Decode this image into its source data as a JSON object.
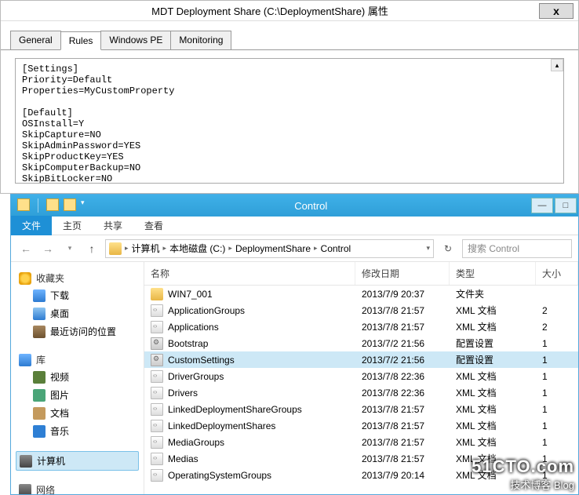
{
  "dialog": {
    "title": "MDT Deployment Share (C:\\DeploymentShare) 属性",
    "close": "x",
    "tabs": [
      "General",
      "Rules",
      "Windows PE",
      "Monitoring"
    ],
    "activeTab": 1,
    "content": "[Settings]\nPriority=Default\nProperties=MyCustomProperty\n\n[Default]\nOSInstall=Y\nSkipCapture=NO\nSkipAdminPassword=YES\nSkipProductKey=YES\nSkipComputerBackup=NO\nSkipBitLocker=NO"
  },
  "explorer": {
    "title": "Control",
    "winbtns": {
      "min": "—",
      "max": "□"
    },
    "ribbon": {
      "file": "文件",
      "tabs": [
        "主页",
        "共享",
        "查看"
      ]
    },
    "nav": {
      "back": "←",
      "fwd": "→",
      "drop": "▾",
      "up": "↑",
      "segs": [
        "计算机",
        "本地磁盘 (C:)",
        "DeploymentShare",
        "Control"
      ],
      "refresh": "↻",
      "searchPlaceholder": "搜索 Control"
    },
    "sidebar": {
      "fav": {
        "label": "收藏夹",
        "items": [
          "下载",
          "桌面",
          "最近访问的位置"
        ]
      },
      "lib": {
        "label": "库",
        "items": [
          "视频",
          "图片",
          "文档",
          "音乐"
        ]
      },
      "comp": {
        "label": "计算机"
      },
      "net": {
        "label": "网络"
      }
    },
    "columns": {
      "name": "名称",
      "date": "修改日期",
      "type": "类型",
      "size": "大小"
    },
    "files": [
      {
        "icon": "fold",
        "name": "WIN7_001",
        "date": "2013/7/9 20:37",
        "type": "文件夹",
        "size": ""
      },
      {
        "icon": "xml",
        "name": "ApplicationGroups",
        "date": "2013/7/8 21:57",
        "type": "XML 文档",
        "size": "2"
      },
      {
        "icon": "xml",
        "name": "Applications",
        "date": "2013/7/8 21:57",
        "type": "XML 文档",
        "size": "2"
      },
      {
        "icon": "cfg",
        "name": "Bootstrap",
        "date": "2013/7/2 21:56",
        "type": "配置设置",
        "size": "1"
      },
      {
        "icon": "cfg",
        "name": "CustomSettings",
        "date": "2013/7/2 21:56",
        "type": "配置设置",
        "size": "1",
        "sel": true
      },
      {
        "icon": "xml",
        "name": "DriverGroups",
        "date": "2013/7/8 22:36",
        "type": "XML 文档",
        "size": "1"
      },
      {
        "icon": "xml",
        "name": "Drivers",
        "date": "2013/7/8 22:36",
        "type": "XML 文档",
        "size": "1"
      },
      {
        "icon": "xml",
        "name": "LinkedDeploymentShareGroups",
        "date": "2013/7/8 21:57",
        "type": "XML 文档",
        "size": "1"
      },
      {
        "icon": "xml",
        "name": "LinkedDeploymentShares",
        "date": "2013/7/8 21:57",
        "type": "XML 文档",
        "size": "1"
      },
      {
        "icon": "xml",
        "name": "MediaGroups",
        "date": "2013/7/8 21:57",
        "type": "XML 文档",
        "size": "1"
      },
      {
        "icon": "xml",
        "name": "Medias",
        "date": "2013/7/8 21:57",
        "type": "XML 文档",
        "size": "1"
      },
      {
        "icon": "xml",
        "name": "OperatingSystemGroups",
        "date": "2013/7/9 20:14",
        "type": "XML 文档",
        "size": "1"
      }
    ]
  },
  "watermark": {
    "l1": "51CTO.com",
    "l2": "技术博客  Blog"
  }
}
